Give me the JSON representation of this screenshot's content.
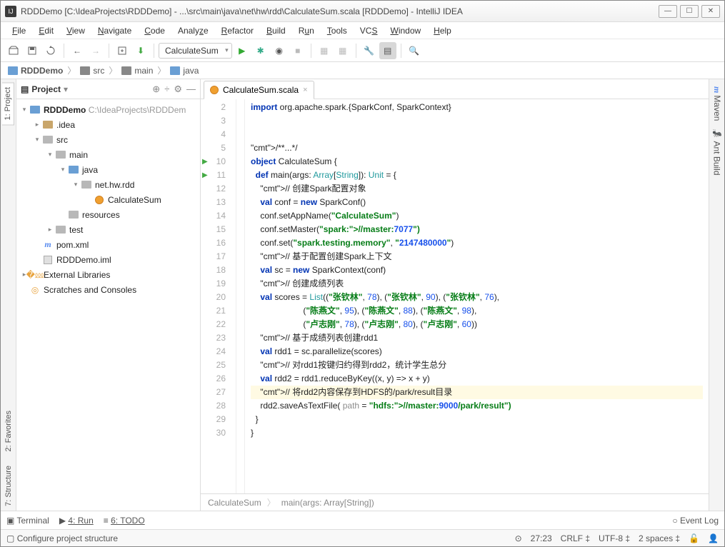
{
  "title": "RDDDemo [C:\\IdeaProjects\\RDDDemo] - ...\\src\\main\\java\\net\\hw\\rdd\\CalculateSum.scala [RDDDemo] - IntelliJ IDEA",
  "menu": [
    "File",
    "Edit",
    "View",
    "Navigate",
    "Code",
    "Analyze",
    "Refactor",
    "Build",
    "Run",
    "Tools",
    "VCS",
    "Window",
    "Help"
  ],
  "runConfig": "CalculateSum",
  "breadcrumb": [
    "RDDDemo",
    "src",
    "main",
    "java"
  ],
  "projectPanel": {
    "title": "Project"
  },
  "tree": {
    "root": {
      "name": "RDDDemo",
      "hint": "C:\\IdeaProjects\\RDDDem"
    },
    "idea": ".idea",
    "src": "src",
    "main": "main",
    "java": "java",
    "pkg": "net.hw.rdd",
    "file": "CalculateSum",
    "resources": "resources",
    "test": "test",
    "pom": "pom.xml",
    "iml": "RDDDemo.iml",
    "ext": "External Libraries",
    "scratch": "Scratches and Consoles"
  },
  "tab": "CalculateSum.scala",
  "lines": [
    "2",
    "3",
    "4",
    "5",
    "10",
    "11",
    "12",
    "13",
    "14",
    "15",
    "16",
    "17",
    "18",
    "19",
    "20",
    "21",
    "22",
    "23",
    "24",
    "25",
    "26",
    "27",
    "28",
    "29",
    "30"
  ],
  "code": {
    "l2": "import org.apache.spark.{SparkConf, SparkContext}",
    "l5": "/**...*/",
    "l10": "object CalculateSum {",
    "l11": "  def main(args: Array[String]): Unit = {",
    "l12": "    // 创建Spark配置对象",
    "l13": "    val conf = new SparkConf()",
    "l14": "    conf.setAppName(\"CalculateSum\")",
    "l15": "    conf.setMaster(\"spark://master:7077\")",
    "l16": "    conf.set(\"spark.testing.memory\", \"2147480000\")",
    "l17": "    // 基于配置创建Spark上下文",
    "l18": "    val sc = new SparkContext(conf)",
    "l19": "    // 创建成绩列表",
    "l20": "    val scores = List((\"张钦林\", 78), (\"张钦林\", 90), (\"张钦林\", 76),",
    "l21": "                      (\"陈燕文\", 95), (\"陈燕文\", 88), (\"陈燕文\", 98),",
    "l22": "                      (\"卢志刚\", 78), (\"卢志刚\", 80), (\"卢志刚\", 60))",
    "l23": "    // 基于成绩列表创建rdd1",
    "l24": "    val rdd1 = sc.parallelize(scores)",
    "l25": "    // 对rdd1按键归约得到rdd2，统计学生总分",
    "l26": "    val rdd2 = rdd1.reduceByKey((x, y) => x + y)",
    "l27": "    // 将rdd2内容保存到HDFS的/park/result目录",
    "l28": "    rdd2.saveAsTextFile( path = \"hdfs://master:9000/park/result\")",
    "l29": "  }",
    "l30": "}"
  },
  "crumbs": [
    "CalculateSum",
    "main(args: Array[String])"
  ],
  "bottom": {
    "terminal": "Terminal",
    "run": "4: Run",
    "todo": "6: TODO",
    "eventlog": "Event Log"
  },
  "status": {
    "msg": "Configure project structure",
    "pos": "27:23",
    "le": "CRLF",
    "enc": "UTF-8",
    "indent": "2 spaces"
  },
  "sideTabs": {
    "project": "1: Project",
    "fav": "2: Favorites",
    "struct": "7: Structure",
    "maven": "Maven",
    "ant": "Ant Build"
  }
}
